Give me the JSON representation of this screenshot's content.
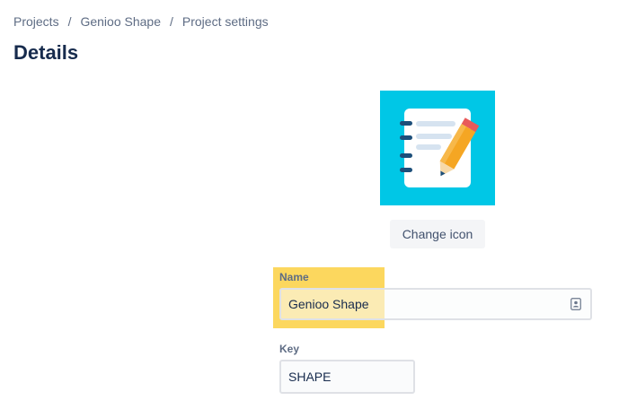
{
  "breadcrumb": {
    "items": [
      "Projects",
      "Genioo Shape",
      "Project settings"
    ],
    "separator": "/"
  },
  "page": {
    "title": "Details"
  },
  "project_icon": {
    "icon": "notebook-pencil-icon",
    "background": "#00c7e6"
  },
  "actions": {
    "change_icon_label": "Change icon"
  },
  "form": {
    "name": {
      "label": "Name",
      "value": "Genioo Shape",
      "icon": "contact-card-icon"
    },
    "key": {
      "label": "Key",
      "value": "SHAPE"
    }
  },
  "colors": {
    "title": "#172b4d",
    "muted": "#5e6c84",
    "highlight": "#fcd34d",
    "field_border": "#dfe1e6"
  }
}
